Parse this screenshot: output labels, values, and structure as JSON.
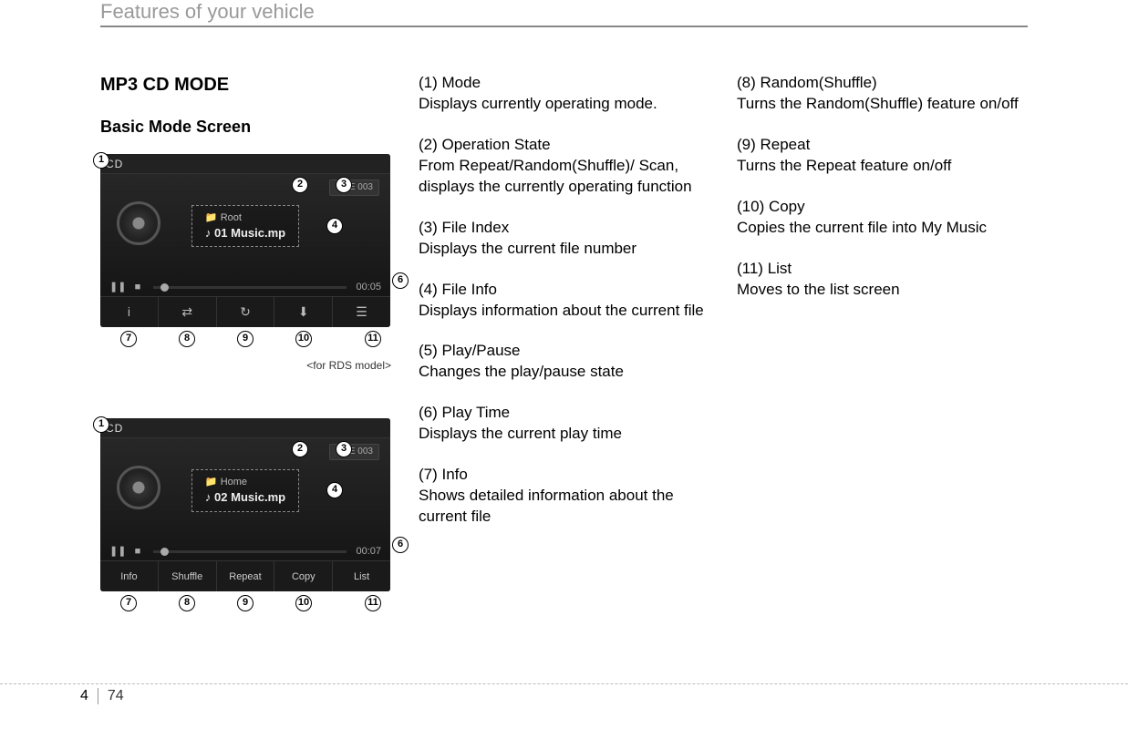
{
  "header": {
    "title": "Features of your vehicle"
  },
  "page": {
    "chapter": "4",
    "number": "74"
  },
  "left": {
    "h1": "MP3 CD MODE",
    "h2": "Basic Mode Screen",
    "caption1": "<for RDS model>",
    "screen1": {
      "cd_label": "CD",
      "file_index": "FILE 003",
      "folder": "Root",
      "track": "01 Music.mp",
      "play_time": "00:05",
      "buttons_icons": [
        "i",
        "⇄",
        "↻",
        "⬇",
        "☰"
      ]
    },
    "screen2": {
      "cd_label": "CD",
      "file_index": "FILE 003",
      "folder": "Home",
      "track": "02 Music.mp",
      "play_time": "00:07",
      "buttons_text": [
        "Info",
        "Shuffle",
        "Repeat",
        "Copy",
        "List"
      ]
    },
    "annot_bottom_labels": [
      "7",
      "8",
      "9",
      "10",
      "11"
    ],
    "annot_side_labels": {
      "n1": "1",
      "n2": "2",
      "n3": "3",
      "n4": "4",
      "n6": "6"
    }
  },
  "items": {
    "i1": {
      "title": "(1) Mode",
      "desc": "Displays currently operating mode."
    },
    "i2": {
      "title": "(2) Operation State",
      "desc": "From Repeat/Random(Shuffle)/ Scan, displays the currently operating function"
    },
    "i3": {
      "title": "(3) File Index",
      "desc": "Displays the current file number"
    },
    "i4": {
      "title": "(4) File Info",
      "desc": "Displays information about the current file"
    },
    "i5": {
      "title": "(5) Play/Pause",
      "desc": "Changes the play/pause state"
    },
    "i6": {
      "title": "(6) Play Time",
      "desc": "Displays the current play time"
    },
    "i7": {
      "title": "(7) Info",
      "desc": "Shows detailed information about the current file"
    },
    "i8": {
      "title": "(8) Random(Shuffle)",
      "desc": "Turns the Random(Shuffle) feature on/off"
    },
    "i9": {
      "title": "(9) Repeat",
      "desc": "Turns the Repeat feature on/off"
    },
    "i10": {
      "title": "(10) Copy",
      "desc": "Copies the current file into My Music"
    },
    "i11": {
      "title": "(11) List",
      "desc": "Moves to the list screen"
    }
  }
}
